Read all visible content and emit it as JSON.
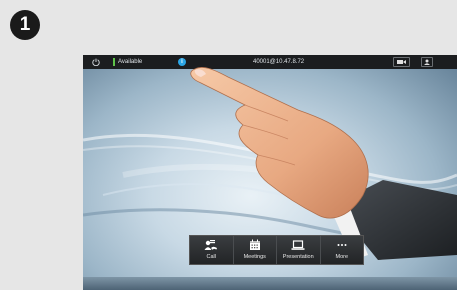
{
  "step": {
    "number": "1"
  },
  "status_bar": {
    "presence": "Available",
    "presence_color": "#5fc34a",
    "address": "40001@10.47.8.72",
    "info_icon_color": "#2ba6e6",
    "icons": [
      "power-icon",
      "info-icon",
      "camera-icon",
      "selfview-icon"
    ]
  },
  "menu": {
    "items": [
      {
        "label": "Call",
        "icon": "call-icon"
      },
      {
        "label": "Meetings",
        "icon": "calendar-icon"
      },
      {
        "label": "Presentation",
        "icon": "laptop-icon"
      },
      {
        "label": "More",
        "icon": "more-icon"
      }
    ]
  }
}
